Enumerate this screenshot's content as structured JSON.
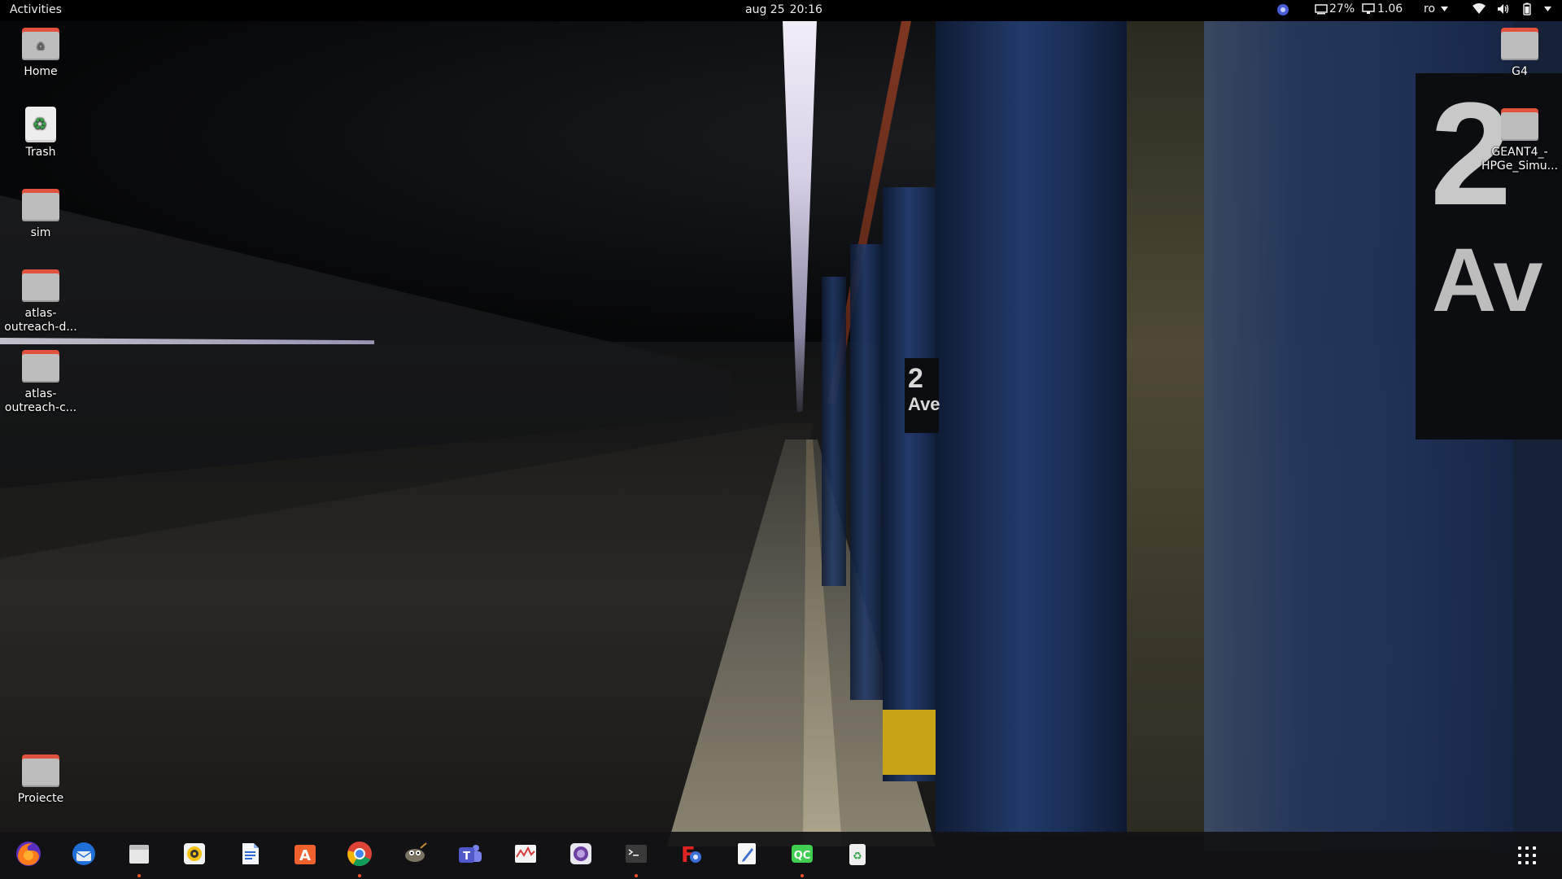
{
  "topbar": {
    "activities": "Activities",
    "date": "aug 25",
    "time": "20:16",
    "cpu_percent": "27%",
    "load": "1.06",
    "language": "ro",
    "icons": [
      "gnome-extension-icon",
      "cpu-monitor-icon",
      "load-monitor-icon",
      "chevron-down-icon",
      "wifi-icon",
      "volume-icon",
      "battery-icon",
      "power-menu-chevron-icon"
    ]
  },
  "desktop": {
    "left_icons": [
      {
        "label": "Home",
        "icon": "home-folder-icon"
      },
      {
        "label": "Trash",
        "icon": "trash-icon"
      },
      {
        "label": "sim",
        "icon": "folder-icon"
      },
      {
        "label": "atlas-outreach-d...",
        "icon": "folder-icon"
      },
      {
        "label": "atlas-outreach-c...",
        "icon": "folder-icon"
      },
      {
        "label": "Proiecte",
        "icon": "folder-icon"
      }
    ],
    "right_icons": [
      {
        "label": "G4",
        "icon": "folder-icon"
      },
      {
        "label": "GEANT4_-HPGe_Simu...",
        "icon": "folder-icon"
      }
    ]
  },
  "wallpaper": {
    "sign_large_line1": "2",
    "sign_large_line2": "Av",
    "sign_small_line1": "2",
    "sign_small_line2": "Ave"
  },
  "dock": {
    "apps": [
      {
        "name": "Firefox",
        "icon": "firefox-icon",
        "running": false
      },
      {
        "name": "Thunderbird",
        "icon": "thunderbird-icon",
        "running": false
      },
      {
        "name": "Files",
        "icon": "files-icon",
        "running": true
      },
      {
        "name": "Rhythmbox",
        "icon": "rhythmbox-icon",
        "running": false
      },
      {
        "name": "LibreOffice Writer",
        "icon": "writer-icon",
        "running": false
      },
      {
        "name": "Ubuntu Software",
        "icon": "software-center-icon",
        "running": false
      },
      {
        "name": "Google Chrome",
        "icon": "chrome-icon",
        "running": true
      },
      {
        "name": "GIMP",
        "icon": "gimp-icon",
        "running": false
      },
      {
        "name": "Microsoft Teams",
        "icon": "teams-icon",
        "running": false
      },
      {
        "name": "System Monitor",
        "icon": "system-monitor-icon",
        "running": false
      },
      {
        "name": "Screenshot",
        "icon": "screenshot-icon",
        "running": false
      },
      {
        "name": "Terminal",
        "icon": "terminal-icon",
        "running": true
      },
      {
        "name": "FreeFileSync",
        "icon": "freefilesync-icon",
        "running": false
      },
      {
        "name": "Text Editor",
        "icon": "text-editor-icon",
        "running": false
      },
      {
        "name": "Qt Creator",
        "icon": "qt-creator-icon",
        "running": true
      },
      {
        "name": "Trash",
        "icon": "trash-icon",
        "running": false
      }
    ],
    "show_apps_icon": "show-applications-grid-icon",
    "running_indicator_color": "#e95420"
  }
}
